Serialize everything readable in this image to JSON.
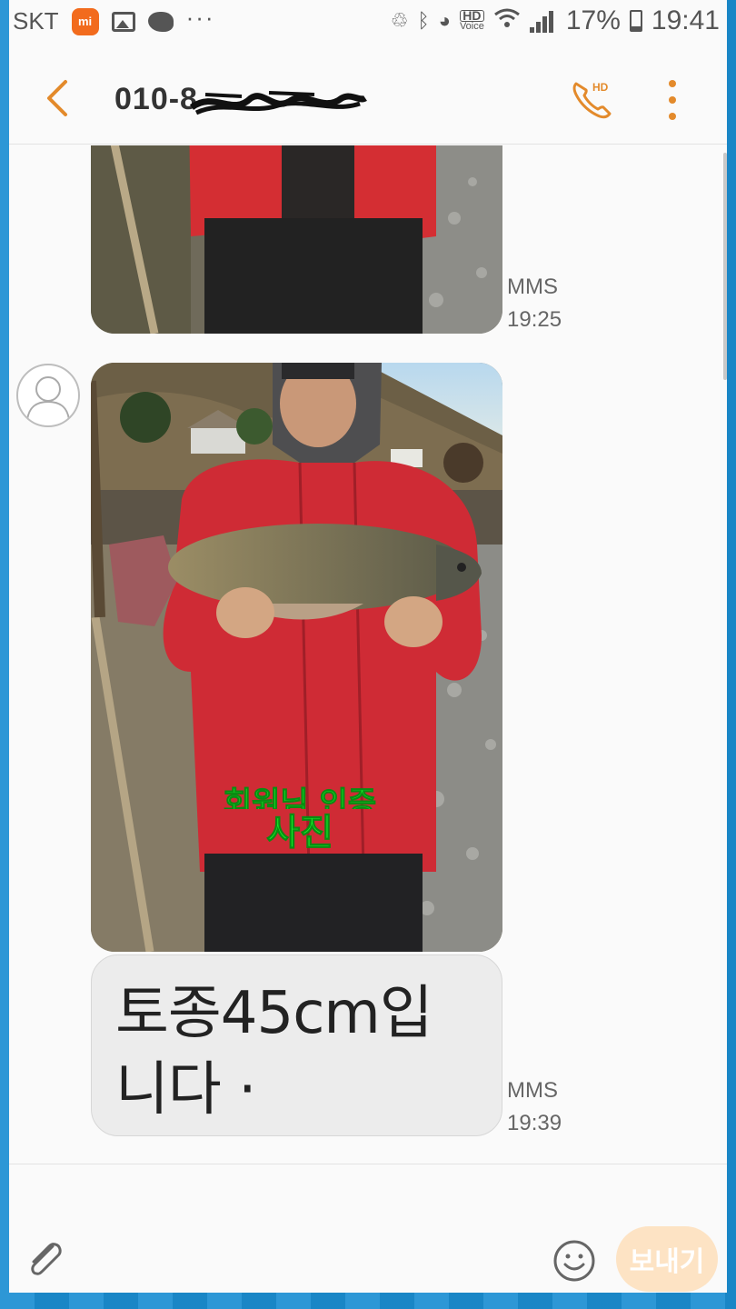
{
  "status_bar": {
    "carrier": "SKT",
    "more": "···",
    "hd_voice_top": "HD",
    "hd_voice_bottom": "Voice",
    "battery": "17%",
    "time": "19:41"
  },
  "app_bar": {
    "contact_number": "010-8",
    "call_icon": "hd-call-icon",
    "menu_icon": "more-vert-icon"
  },
  "messages": [
    {
      "type": "MMS",
      "time": "19:25"
    },
    {
      "type": "MMS",
      "time": "19:39",
      "text_line1": "토종45cm입",
      "text_line2": "니다 ·"
    }
  ],
  "photo_overlay": {
    "line1": "회원님 인증",
    "line2": "사진"
  },
  "compose": {
    "send_label": "보내기",
    "attach_icon": "paperclip-icon",
    "emoji_icon": "smiley-icon"
  },
  "colors": {
    "accent": "#e38a2b",
    "send_disabled": "#fde3c4",
    "frame": "#1b8ed2"
  }
}
